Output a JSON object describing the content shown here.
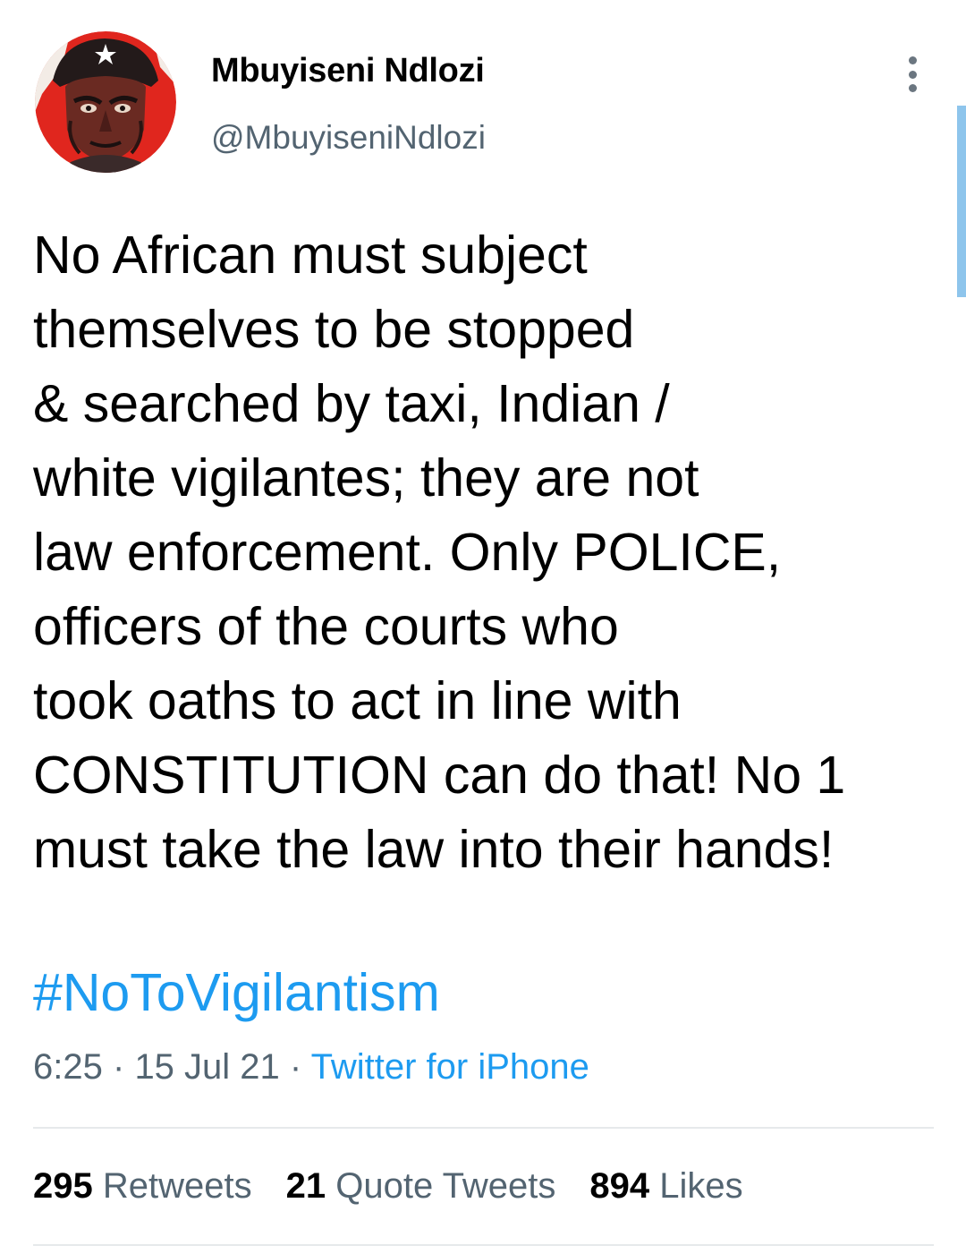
{
  "tweet": {
    "author": {
      "name": "Mbuyiseni Ndlozi",
      "handle": "@MbuyiseniNdlozi"
    },
    "text_lines": [
      "No African must subject",
      "themselves to be stopped",
      "& searched by taxi, Indian /",
      "white vigilantes; they are not",
      "law enforcement. Only POLICE,",
      "officers of the courts who",
      "took oaths to act in line with",
      "CONSTITUTION can do that! No 1",
      "must take the law into their hands!"
    ],
    "hashtag": "#NoToVigilantism",
    "time": "6:25",
    "separator": "·",
    "date": "15 Jul 21",
    "source": "Twitter for iPhone",
    "stats": {
      "retweets_count": "295",
      "retweets_label": "Retweets",
      "quotes_count": "21",
      "quotes_label": "Quote Tweets",
      "likes_count": "894",
      "likes_label": "Likes"
    }
  },
  "icons": {
    "more": "more-vertical-icon"
  },
  "colors": {
    "link": "#1d9bf0",
    "secondary_text": "#536471",
    "avatar_red": "#e0261e"
  }
}
